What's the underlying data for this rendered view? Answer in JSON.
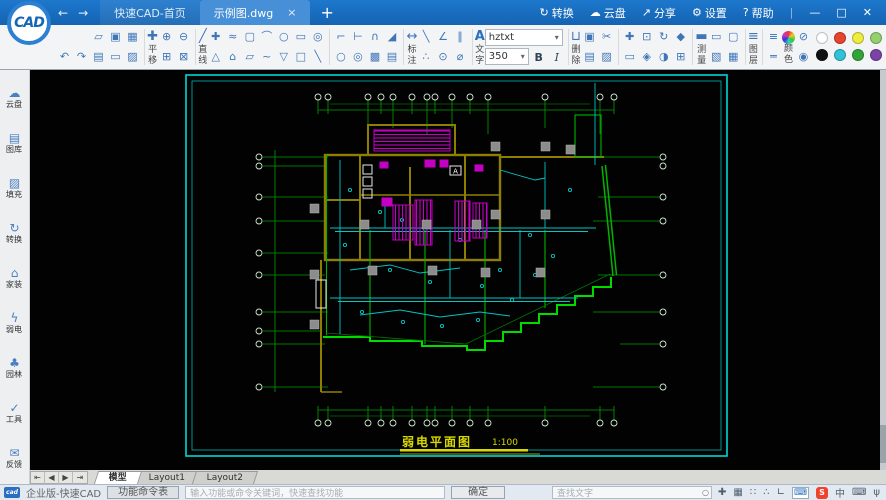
{
  "titlebar": {
    "logo_text": "CAD",
    "back_icon": "←",
    "forward_icon": "→",
    "tabs": [
      {
        "label": "快速CAD-首页"
      },
      {
        "label": "示例图.dwg",
        "close_icon": "×"
      }
    ],
    "new_tab_icon": "+",
    "actions": [
      {
        "icon": "↻",
        "label": "转换"
      },
      {
        "icon": "☁",
        "label": "云盘"
      },
      {
        "icon": "↗",
        "label": "分享"
      },
      {
        "icon": "⚙",
        "label": "设置"
      },
      {
        "icon": "?",
        "label": "帮助"
      }
    ],
    "window_controls": {
      "minimize": "—",
      "maximize": "□",
      "close": "✕"
    }
  },
  "toolbar": {
    "labels": {
      "pan": "平移",
      "line": "直线",
      "dim": "标注",
      "text": "文字",
      "delete": "删除",
      "measure": "测量",
      "layer": "图层",
      "color": "颜色"
    },
    "font_value": "hztxt",
    "size_value": "350",
    "bold": "B",
    "italic": "I",
    "caret": "▾",
    "icons": {
      "undo": "↶",
      "redo": "↷",
      "open": "▱",
      "save": "▣",
      "save_as": "▦",
      "print": "▤",
      "pdf": "▭",
      "image": "▨",
      "pan": "✚",
      "zoom_in": "⊕",
      "zoom_out": "⊖",
      "zoom_window": "⊞",
      "zoom_extents": "⊠",
      "line": "╱",
      "move_pt": "✚",
      "polyline": "≈",
      "rounded_rect": "▢",
      "arc": "⌒",
      "circle": "○",
      "rectangle": "▭",
      "ellipse": "◎",
      "triangle": "△",
      "pentagon": "⌂",
      "parallelogram": "▱",
      "spline": "~",
      "trapezoid": "▽",
      "rect2": "□",
      "diagonal": "╲",
      "trim": "⌐",
      "extend": "⊢",
      "fillet": "∩",
      "chamfer": "◢",
      "circle2": "○",
      "donut": "◎",
      "hatch": "▩",
      "region": "▤",
      "dimension": "↔",
      "dim_aligned": "╲",
      "dim_angular": "∠",
      "dim_parallel": "∥",
      "dim_point": "∴",
      "dim_center": "⊙",
      "dim_diameter": "⌀",
      "text": "A",
      "delete": "⊔",
      "copy": "▣",
      "cut": "✂",
      "paste": "▤",
      "brush": "▨",
      "move": "✚",
      "scale": "⊡",
      "rotate": "↻",
      "block": "◆",
      "wipe": "▭",
      "align": "◈",
      "mirror": "◑",
      "array": "⊞",
      "measure": "▬",
      "m_area": "▭",
      "m_screen": "▢",
      "m_image": "▧",
      "m_table": "▦",
      "layers": "≡",
      "linetype1": "≡",
      "linetype2": "═",
      "no_color": "⊘",
      "match": "◉"
    },
    "swatches": [
      "#ffffff",
      "#e8432d",
      "#efed3c",
      "#95d06e",
      "#111111",
      "#30c3d8",
      "#33a43a",
      "#7d42a8"
    ]
  },
  "sidebar": {
    "items": [
      {
        "icon": "☁",
        "label": "云盘"
      },
      {
        "icon": "▤",
        "label": "图库"
      },
      {
        "icon": "▨",
        "label": "填充"
      },
      {
        "icon": "↻",
        "label": "转换"
      },
      {
        "icon": "⌂",
        "label": "家装"
      },
      {
        "icon": "ϟ",
        "label": "弱电"
      },
      {
        "icon": "♣",
        "label": "园林"
      },
      {
        "icon": "✓",
        "label": "工具"
      },
      {
        "icon": "✉",
        "label": "反馈"
      }
    ]
  },
  "canvas": {
    "title": "弱电平面图",
    "scale": "1:100",
    "marker": "A"
  },
  "layout_tabs": {
    "nav": [
      "⇤",
      "◀",
      "▶",
      "⇥"
    ],
    "items": [
      {
        "label": "模型"
      },
      {
        "label": "Layout1"
      },
      {
        "label": "Layout2"
      }
    ]
  },
  "statusbar": {
    "logo_text": "cad",
    "brand": "企业版-快速CAD",
    "command_button": "功能命令表",
    "command_placeholder": "输入功能或命令关键词，快速查找功能",
    "confirm_button": "确定",
    "find_placeholder": "查找文字",
    "mag_icon": "○",
    "icons": {
      "snap": "✚",
      "grid": "▦",
      "dots": "∷",
      "osnap": "∴",
      "ortho": "∟"
    },
    "ime": {
      "panel": "⌨",
      "sogou": "S",
      "lang": "中",
      "keyboard": "⌨",
      "mic": "ψ"
    }
  }
}
